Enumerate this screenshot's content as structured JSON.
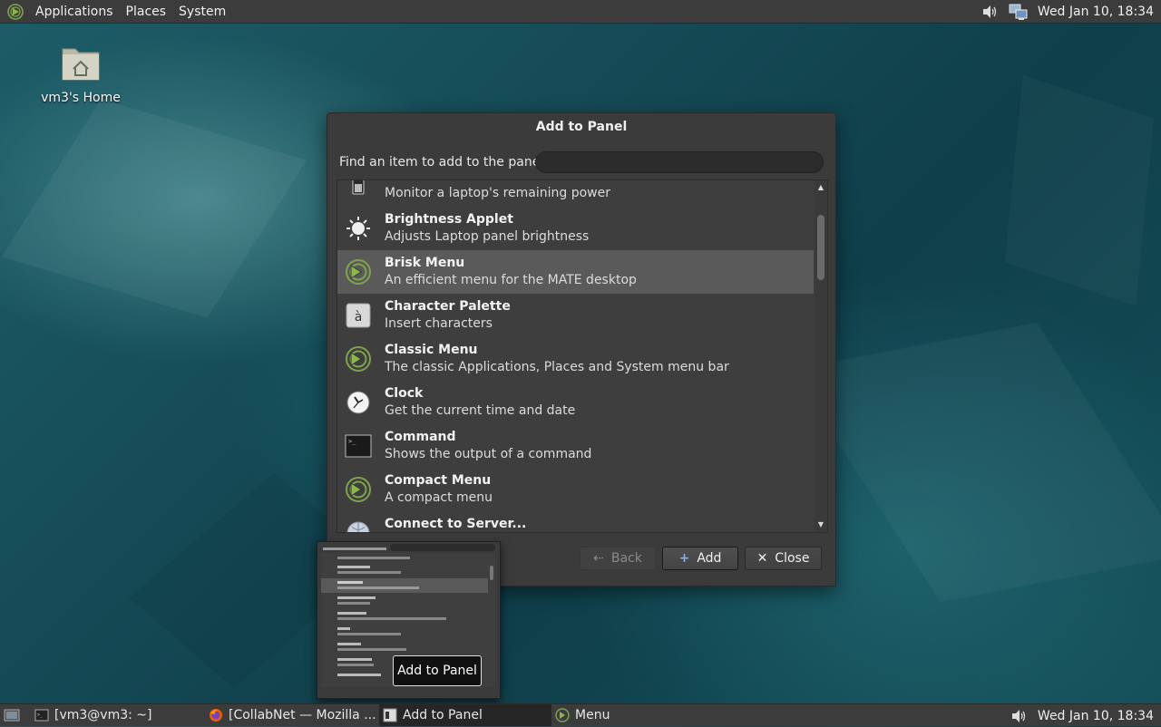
{
  "top_panel": {
    "menus": [
      "Applications",
      "Places",
      "System"
    ],
    "clock": "Wed Jan 10, 18:34"
  },
  "desktop": {
    "home_icon_label": "vm3's Home"
  },
  "dialog": {
    "title": "Add to Panel",
    "find_label": "Find an item to add to the panel:",
    "find_value": "",
    "items": [
      {
        "name": "",
        "desc": "Monitor a laptop's remaining power",
        "icon": "battery-icon"
      },
      {
        "name": "Brightness Applet",
        "desc": "Adjusts Laptop panel brightness",
        "icon": "brightness-icon"
      },
      {
        "name": "Brisk Menu",
        "desc": "An efficient menu for the MATE desktop",
        "icon": "brisk-menu-icon"
      },
      {
        "name": "Character Palette",
        "desc": "Insert characters",
        "icon": "character-palette-icon"
      },
      {
        "name": "Classic Menu",
        "desc": "The classic Applications, Places and System menu bar",
        "icon": "classic-menu-icon"
      },
      {
        "name": "Clock",
        "desc": "Get the current time and date",
        "icon": "clock-icon"
      },
      {
        "name": "Command",
        "desc": "Shows the output of a command",
        "icon": "terminal-icon"
      },
      {
        "name": "Compact Menu",
        "desc": "A compact menu",
        "icon": "compact-menu-icon"
      },
      {
        "name": "Connect to Server...",
        "desc": "",
        "icon": "network-server-icon"
      }
    ],
    "selected_index": 2,
    "buttons": {
      "back": "Back",
      "add": "Add",
      "close": "Close"
    }
  },
  "preview": {
    "tooltip": "Add to Panel"
  },
  "bottom_panel": {
    "tasks": [
      {
        "label": "[vm3@vm3: ~]",
        "icon": "terminal-icon"
      },
      {
        "label": "[CollabNet — Mozilla ...",
        "icon": "firefox-icon"
      },
      {
        "label": "Add to Panel",
        "icon": "window-icon"
      },
      {
        "label": "Menu",
        "icon": "mate-menu-icon"
      }
    ],
    "clock": "Wed Jan 10, 18:34"
  },
  "colors": {
    "panel": "#3c3c3c",
    "dialog": "#3b3b3b",
    "selection": "#5a5a5a",
    "desktop": "#155560",
    "menu_green": "#8ab84a"
  }
}
